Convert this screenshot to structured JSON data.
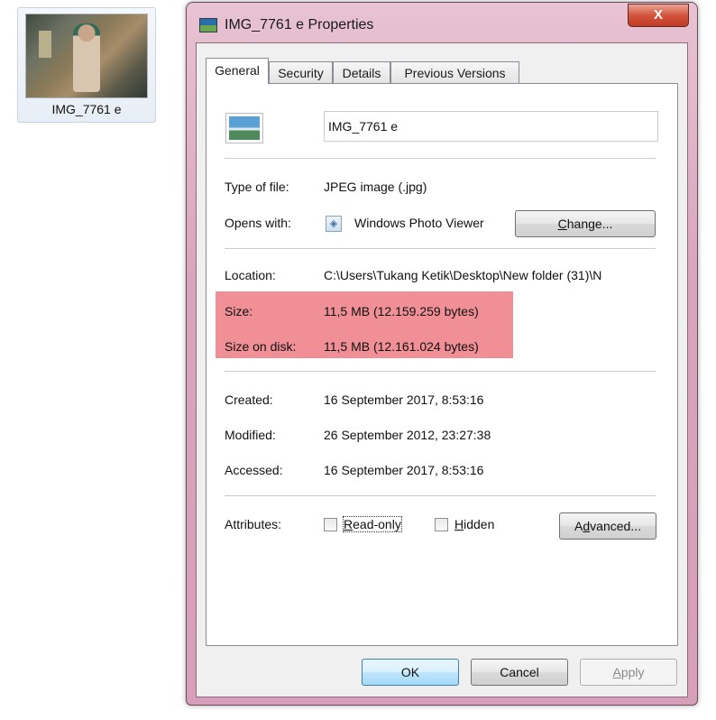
{
  "desktop": {
    "icon_label": "IMG_7761 e"
  },
  "window": {
    "title": "IMG_7761 e Properties",
    "close_glyph": "X"
  },
  "tabs": [
    {
      "label": "General",
      "active": true
    },
    {
      "label": "Security",
      "active": false
    },
    {
      "label": "Details",
      "active": false
    },
    {
      "label": "Previous Versions",
      "active": false
    }
  ],
  "general": {
    "file_name": "IMG_7761 e",
    "type_label": "Type of file:",
    "type_value": "JPEG image (.jpg)",
    "opens_label": "Opens with:",
    "opens_value": "Windows Photo Viewer",
    "change_button": {
      "pre": "",
      "mnemonic": "C",
      "post": "hange..."
    },
    "location_label": "Location:",
    "location_value": "C:\\Users\\Tukang Ketik\\Desktop\\New folder (31)\\N",
    "size_label": "Size:",
    "size_value": "11,5 MB (12.159.259 bytes)",
    "size_disk_label": "Size on disk:",
    "size_disk_value": "11,5 MB (12.161.024 bytes)",
    "created_label": "Created:",
    "created_value": "16 September 2017, 8:53:16",
    "modified_label": "Modified:",
    "modified_value": "26 September 2012, 23:27:38",
    "accessed_label": "Accessed:",
    "accessed_value": "16 September 2017, 8:53:16",
    "attributes_label": "Attributes:",
    "readonly": {
      "mnemonic": "R",
      "rest": "ead-only",
      "checked": false
    },
    "hidden": {
      "mnemonic": "H",
      "rest": "idden",
      "checked": false
    },
    "advanced_button": {
      "pre": "A",
      "mnemonic": "d",
      "post": "vanced..."
    },
    "highlight_color": "#f08f95"
  },
  "footer": {
    "ok": "OK",
    "cancel": "Cancel",
    "apply": {
      "mnemonic": "A",
      "rest": "pply"
    }
  },
  "colors": {
    "window_frame": "#d9a4bd",
    "close_button": "#c13a22",
    "default_button": "#a7d9f5"
  },
  "icons": [
    "image-file-icon",
    "photo-viewer-icon",
    "close-icon",
    "window-app-icon"
  ]
}
